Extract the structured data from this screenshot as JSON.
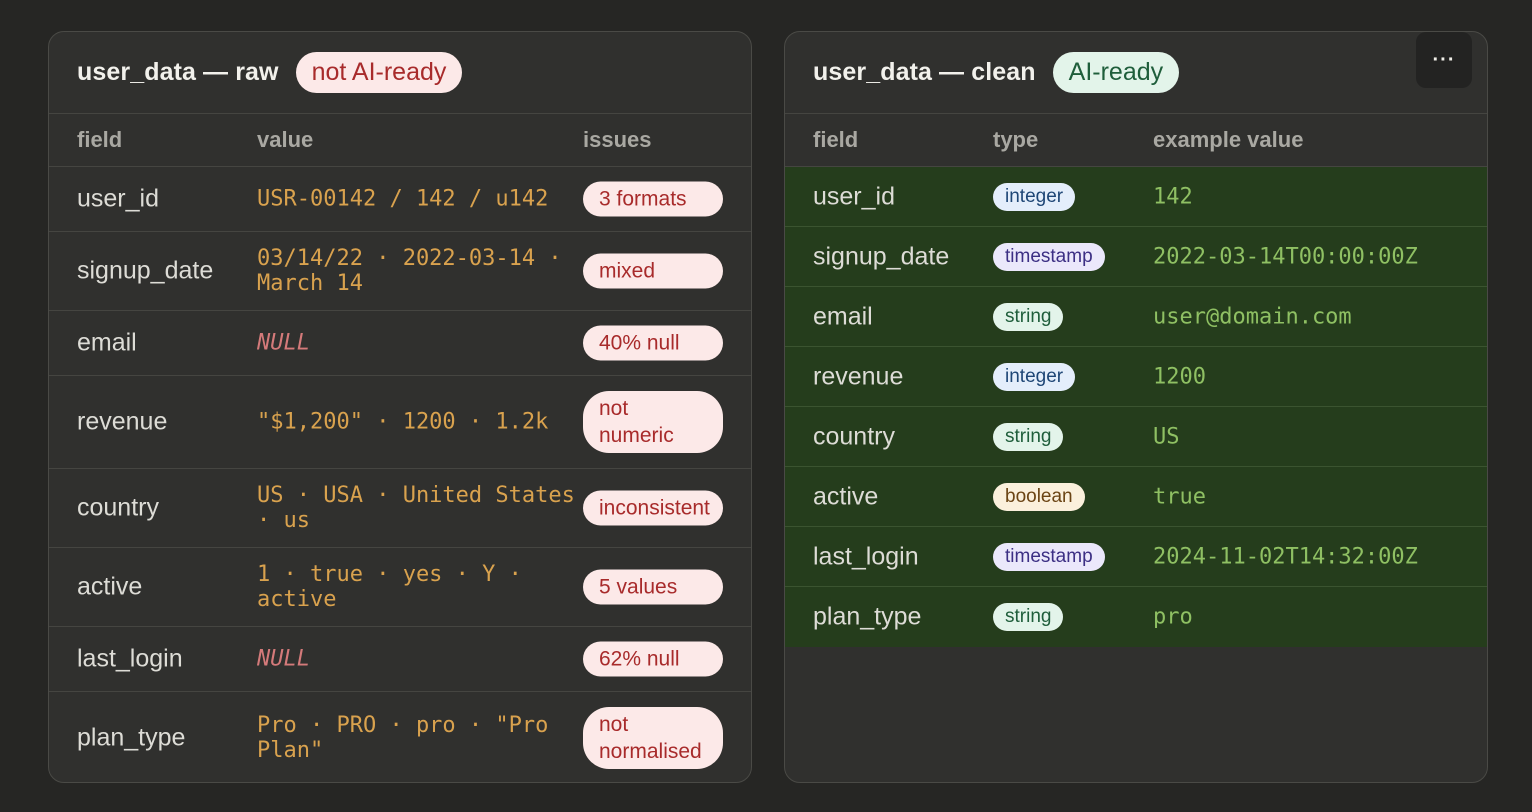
{
  "raw": {
    "title": "user_data — raw",
    "status": "not AI-ready",
    "columns": {
      "field": "field",
      "value": "value",
      "issues": "issues"
    },
    "rows": [
      {
        "field": "user_id",
        "value": "USR-00142 / 142 / u142",
        "issue": "3 formats"
      },
      {
        "field": "signup_date",
        "value": "03/14/22 · 2022-03-14 · March 14",
        "issue": "mixed"
      },
      {
        "field": "email",
        "value": "NULL",
        "issue": "40% null"
      },
      {
        "field": "revenue",
        "value": "\"$1,200\" · 1200 · 1.2k",
        "issue": "not numeric"
      },
      {
        "field": "country",
        "value": "US · USA · United States · us",
        "issue": "inconsistent"
      },
      {
        "field": "active",
        "value": "1 · true · yes · Y · active",
        "issue": "5 values"
      },
      {
        "field": "last_login",
        "value": "NULL",
        "issue": "62% null"
      },
      {
        "field": "plan_type",
        "value": "Pro · PRO · pro · \"Pro Plan\"",
        "issue": "not normalised"
      }
    ]
  },
  "clean": {
    "title": "user_data — clean",
    "status": "AI-ready",
    "more_icon": "more-horizontal-icon",
    "more_label": "···",
    "columns": {
      "field": "field",
      "type": "type",
      "example": "example value"
    },
    "rows": [
      {
        "field": "user_id",
        "type": "integer",
        "example": "142"
      },
      {
        "field": "signup_date",
        "type": "timestamp",
        "example": "2022-03-14T00:00:00Z"
      },
      {
        "field": "email",
        "type": "string",
        "example": "user@domain.com"
      },
      {
        "field": "revenue",
        "type": "integer",
        "example": "1200"
      },
      {
        "field": "country",
        "type": "string",
        "example": "US"
      },
      {
        "field": "active",
        "type": "boolean",
        "example": "true"
      },
      {
        "field": "last_login",
        "type": "timestamp",
        "example": "2024-11-02T14:32:00Z"
      },
      {
        "field": "plan_type",
        "type": "string",
        "example": "pro"
      }
    ]
  },
  "colors": {
    "background": "#262624",
    "panel": "#30302e",
    "raw_value": "#d9a24e",
    "null_value": "#d47a7a",
    "issue_pill_bg": "#fce9e8",
    "issue_pill_text": "#a82b2b",
    "clean_row_bg": "#253d1c",
    "clean_value": "#8fc063"
  }
}
